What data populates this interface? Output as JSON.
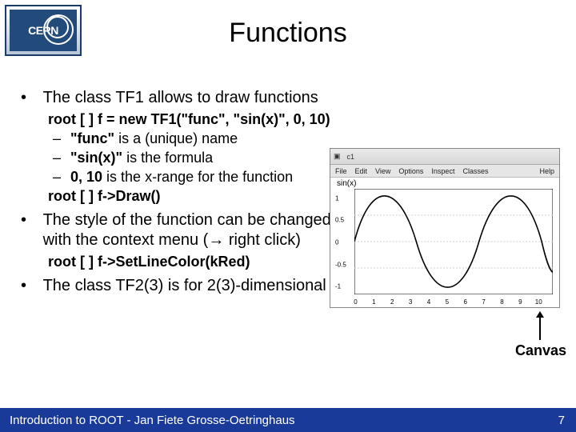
{
  "logo_text": "CERN",
  "title": "Functions",
  "bullet1": "The class TF1 allows to draw functions",
  "code1_prefix": "root [ ] ",
  "code1": "f = new TF1(\"func\", \"sin(x)\", 0, 10)",
  "sub1_b": "\"func\"",
  "sub1_t": " is a (unique) name",
  "sub2_b": "\"sin(x)\"",
  "sub2_t": " is the formula",
  "sub3_b": "0, 10",
  "sub3_t": " is the x-range for the function",
  "code2_prefix": "root [ ] ",
  "code2": "f->Draw()",
  "bullet2": "The style of the function can be changed on the command line or with the context menu (→ right click)",
  "code3_prefix": "root [ ] ",
  "code3": "f->SetLineColor(kRed)",
  "bullet3": "The class TF2(3) is for 2(3)-dimensional functions",
  "canvas_label": "Canvas",
  "footer_left": "Introduction to ROOT - Jan Fiete Grosse-Oetringhaus",
  "footer_right": "7",
  "fig_bar": "c1",
  "fig_help": "Help",
  "fig_menu": [
    "File",
    "Edit",
    "View",
    "Options",
    "Inspect",
    "Classes"
  ],
  "plot_title": "sin(x)",
  "chart_data": {
    "type": "line",
    "title": "sin(x)",
    "xlim": [
      0,
      10
    ],
    "ylim": [
      -1,
      1
    ],
    "xticks": [
      0,
      1,
      2,
      3,
      4,
      5,
      6,
      7,
      8,
      9,
      10
    ],
    "yticks": [
      -1,
      -0.5,
      0,
      0.5,
      1
    ],
    "series": [
      {
        "name": "sin(x)",
        "formula": "sin(x)"
      }
    ]
  }
}
